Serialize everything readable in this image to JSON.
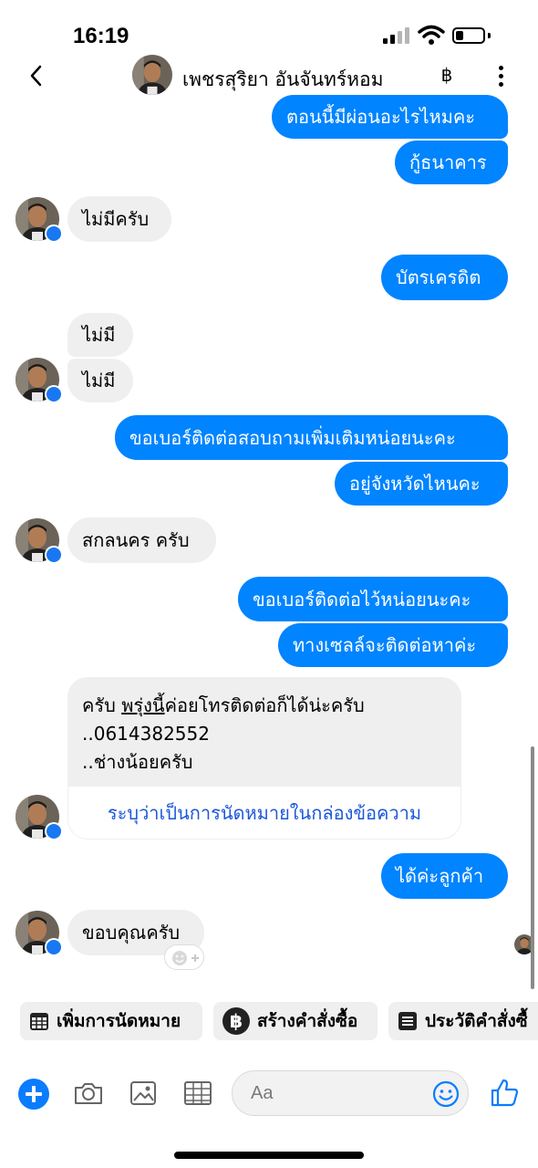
{
  "status_bar": {
    "time": "16:19"
  },
  "header": {
    "contact_name": "เพชรสุริยา อันจันทร์หอม",
    "currency_symbol": "฿"
  },
  "messages": [
    {
      "text": "ตอนนี้มีผ่อนอะไรไหมคะ"
    },
    {
      "text": "กู้ธนาคาร"
    },
    {
      "text": "ไม่มีครับ"
    },
    {
      "text": "บัตรเครดิต"
    },
    {
      "text": "ไม่มี"
    },
    {
      "text": "ไม่มี"
    },
    {
      "text": "ขอเบอร์ติดต่อสอบถามเพิ่มเติมหน่อยนะคะ"
    },
    {
      "text": "อยู่จังหวัดไหนคะ"
    },
    {
      "text": "สกลนคร ครับ"
    },
    {
      "text": "ขอเบอร์ติดต่อไว้หน่อยนะคะ"
    },
    {
      "text": "ทางเซลล์จะติดต่อหาค่ะ"
    },
    {
      "text": "ได้ค่ะลูกค้า"
    },
    {
      "text": "ขอบคุณครับ"
    }
  ],
  "card": {
    "line1_prefix": "ครับ ",
    "line1_link": "พรุ่งนี้",
    "line1_suffix": "ค่อยโทรติดต่อก็ได้น่ะครับ",
    "line2": "..0614382552",
    "line3": "..ช่างน้อยครับ",
    "footer": "ระบุว่าเป็นการนัดหมายในกล่องข้อความ"
  },
  "quick_actions": [
    {
      "label": "เพิ่มการนัดหมาย",
      "icon": "calendar-icon"
    },
    {
      "label": "สร้างคำสั่งซื้อ",
      "icon": "baht-icon"
    },
    {
      "label": "ประวัติคำสั่งซื้",
      "icon": "list-icon"
    }
  ],
  "composer": {
    "placeholder": "Aa"
  },
  "colors": {
    "outgoing": "#0084ff",
    "incoming": "#efefef",
    "link": "#1a56db"
  }
}
